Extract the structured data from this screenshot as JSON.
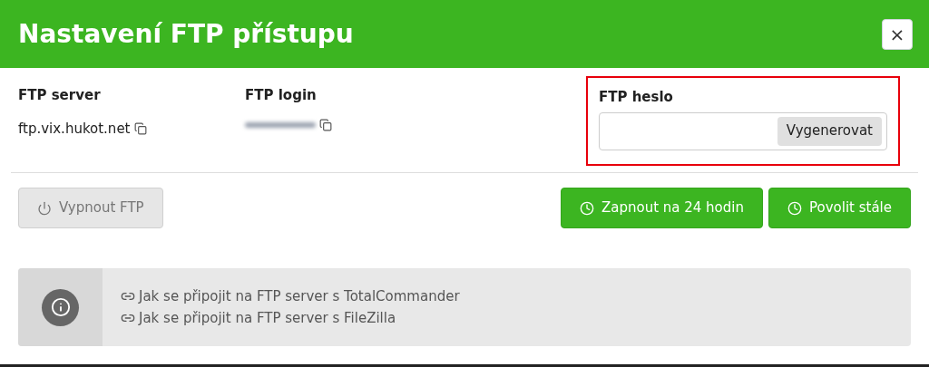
{
  "dialog": {
    "title": "Nastavení FTP přístupu",
    "close_label": "×"
  },
  "fields": [
    {
      "label": "FTP server",
      "value": "ftp.vix.hukot.net",
      "redacted": false
    },
    {
      "label": "FTP login",
      "redacted": true
    }
  ],
  "password": {
    "label": "FTP heslo",
    "button": "Vygenerovat",
    "highlighted": true
  },
  "actions": [
    {
      "kind": "power",
      "label": "Vypnout FTP",
      "disabled": true
    },
    {
      "kind": "clock",
      "label": "Zapnout na 24 hodin",
      "disabled": false
    },
    {
      "kind": "clock",
      "label": "Povolit stále",
      "disabled": false
    }
  ],
  "info_links": [
    "Jak se připojit na FTP server s TotalCommander",
    "Jak se připojit na FTP server s FileZilla"
  ]
}
